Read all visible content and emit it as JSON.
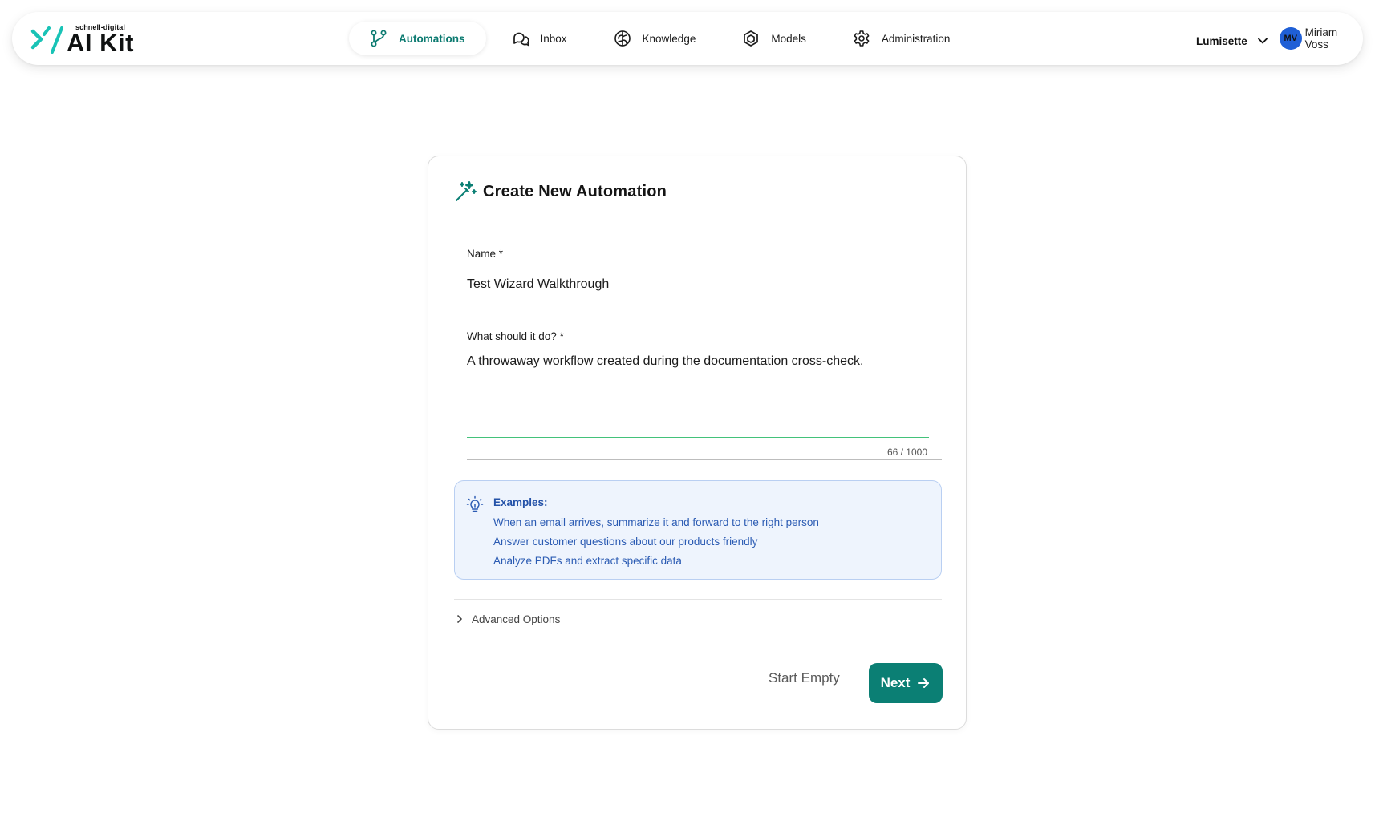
{
  "brand": {
    "small": "schnell-digital",
    "main": "AI Kit",
    "colors": {
      "cyan": "#19c3b6",
      "dark": "#0f1111"
    }
  },
  "nav": {
    "items": [
      {
        "label": "Automations",
        "icon": "workflow-icon",
        "active": true
      },
      {
        "label": "Inbox",
        "icon": "chat-bubbles-icon",
        "active": false
      },
      {
        "label": "Knowledge",
        "icon": "brain-icon",
        "active": false
      },
      {
        "label": "Models",
        "icon": "cube-icon",
        "active": false
      },
      {
        "label": "Administration",
        "icon": "gear-icon",
        "active": false
      }
    ]
  },
  "workspace": {
    "name": "Lumisette"
  },
  "user": {
    "initials": "MV",
    "name": "Miriam Voss",
    "avatar_color": "#1f5fd6"
  },
  "form": {
    "title": "Create New Automation",
    "name_label": "Name *",
    "name_value": "Test Wizard Walkthrough",
    "desc_label": "What should it do? *",
    "desc_value": "A throwaway workflow created during the documentation cross-check.",
    "char_count": "66 / 1000",
    "examples": {
      "title": "Examples:",
      "items": [
        "When an email arrives, summarize it and forward to the right person",
        "Answer customer questions about our products friendly",
        "Analyze PDFs and extract specific data"
      ]
    },
    "advanced_label": "Advanced Options",
    "start_empty_label": "Start Empty",
    "next_label": "Next"
  },
  "colors": {
    "accent": "#0b7f74",
    "accent_text": "#0b7a70",
    "examples_bg": "#eef4fd",
    "examples_text": "#2b5bb3",
    "focus_line": "#43c27a"
  }
}
